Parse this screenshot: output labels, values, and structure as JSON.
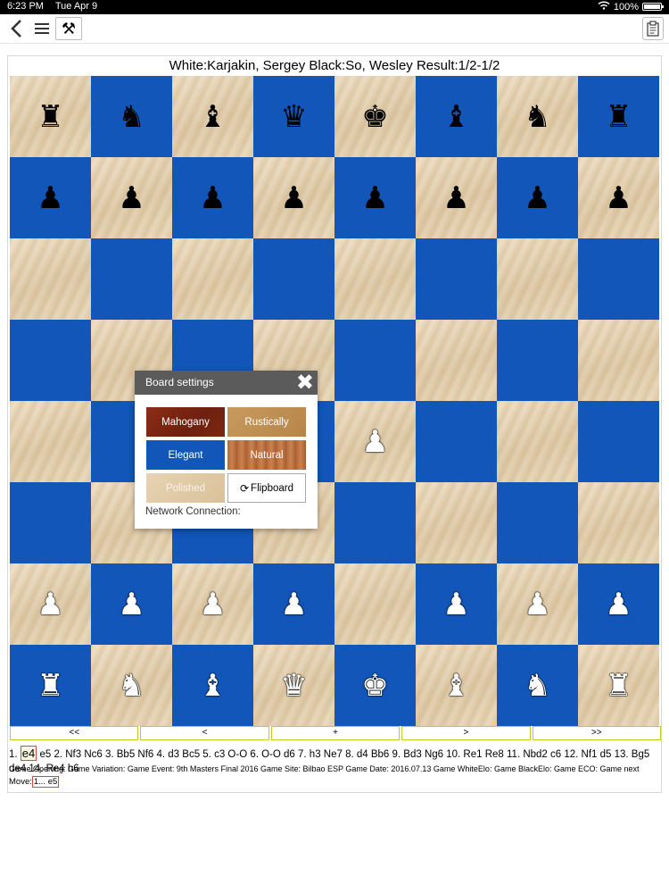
{
  "status_bar": {
    "time": "6:23 PM",
    "date": "Tue Apr 9",
    "battery": "100%"
  },
  "game": {
    "header": "White:Karjakin, Sergey  Black:So, Wesley  Result:1/2-1/2",
    "first_move_prefix": "1. ",
    "first_move": "e4",
    "moves_rest": " e5 2. Nf3 Nc6 3. Bb5 Nf6 4. d3 Bc5 5. c3 O-O 6. O-O d6 7. h3 Ne7 8. d4 Bb6 9. Bd3 Ng6 10. Re1 Re8 11. Nbd2 c6 12. Nf1 d5 13. Bg5 de4 14. Re4 h6",
    "info": "Game Opening:   Game Variation: Game Event: 9th Masters Final 2016 Game Site: Bilbao ESP Game Date: 2016.07.13 Game WhiteElo: Game BlackElo: Game ECO: Game next",
    "move_label": "Move:",
    "current_move": "1... e5"
  },
  "board": {
    "theme_colors": {
      "light": "#e2ceac",
      "dark": "#1156b8"
    },
    "ranks": [
      [
        "b:rook",
        "b:knight",
        "b:bishop",
        "b:queen",
        "b:king",
        "b:bishop",
        "b:knight",
        "b:rook"
      ],
      [
        "b:pawn",
        "b:pawn",
        "b:pawn",
        "b:pawn",
        "b:pawn",
        "b:pawn",
        "b:pawn",
        "b:pawn"
      ],
      [
        "",
        "",
        "",
        "",
        "",
        "",
        "",
        ""
      ],
      [
        "",
        "",
        "",
        "",
        "",
        "",
        "",
        ""
      ],
      [
        "",
        "",
        "",
        "",
        "w:pawn",
        "",
        "",
        ""
      ],
      [
        "",
        "",
        "",
        "",
        "",
        "",
        "",
        ""
      ],
      [
        "w:pawn",
        "w:pawn",
        "w:pawn",
        "w:pawn",
        "",
        "w:pawn",
        "w:pawn",
        "w:pawn"
      ],
      [
        "w:rook",
        "w:knight",
        "w:bishop",
        "w:queen",
        "w:king",
        "w:bishop",
        "w:knight",
        "w:rook"
      ]
    ]
  },
  "nav": {
    "first": "<<",
    "prev": "<",
    "plus": "+",
    "next": ">",
    "last": ">>"
  },
  "settings": {
    "title": "Board settings",
    "mahogany": "Mahogany",
    "rustically": "Rustically",
    "elegant": "Elegant",
    "natural": "Natural",
    "polished": "Polished",
    "flipboard": "Flipboard",
    "network": "Network Connection:"
  },
  "icons": {
    "back": "chevron-left-icon",
    "menu": "hamburger-icon",
    "tools": "tools-icon",
    "clipboard": "clipboard-icon",
    "close": "close-icon",
    "flip": "refresh-icon"
  }
}
